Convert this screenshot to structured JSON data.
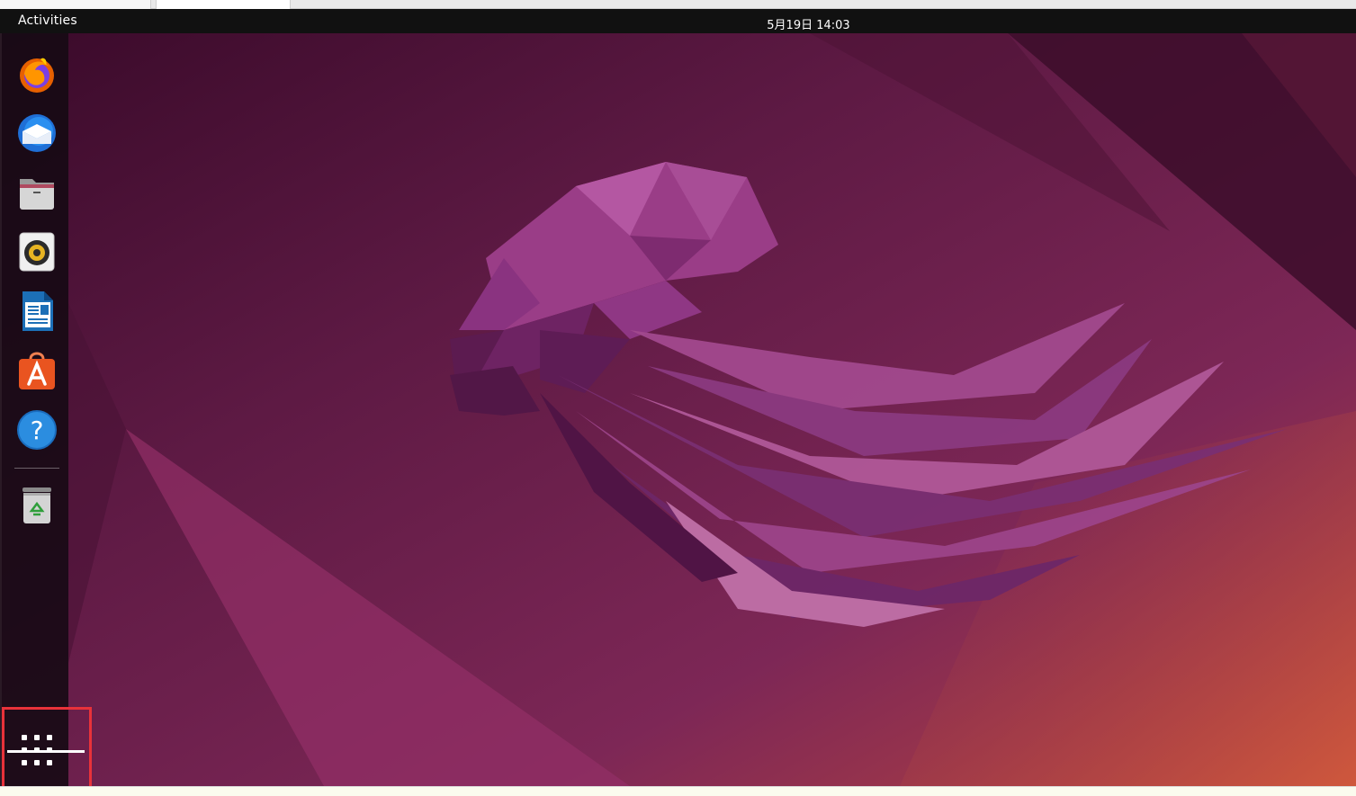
{
  "topbar": {
    "activities_label": "Activities",
    "clock": "5月19日  14:03"
  },
  "dock": {
    "items": [
      {
        "name": "Firefox",
        "icon": "firefox-icon"
      },
      {
        "name": "Thunderbird Mail",
        "icon": "thunderbird-icon"
      },
      {
        "name": "Files",
        "icon": "files-icon"
      },
      {
        "name": "Rhythmbox",
        "icon": "rhythmbox-icon"
      },
      {
        "name": "LibreOffice Writer",
        "icon": "libreoffice-writer-icon"
      },
      {
        "name": "Ubuntu Software",
        "icon": "ubuntu-software-icon"
      },
      {
        "name": "Help",
        "icon": "help-icon"
      },
      {
        "name": "Trash",
        "icon": "trash-icon"
      }
    ],
    "show_apps": {
      "icon": "show-applications-grid-icon"
    }
  },
  "colors": {
    "topbar": "#111111",
    "dock": "#1a0c17",
    "wallpaper_dark": "#3a0c2c",
    "wallpaper_mid": "#7a2456",
    "wallpaper_warm": "#c24c3e",
    "highlight": "#e8323a"
  },
  "help_icon_glyph": "?"
}
